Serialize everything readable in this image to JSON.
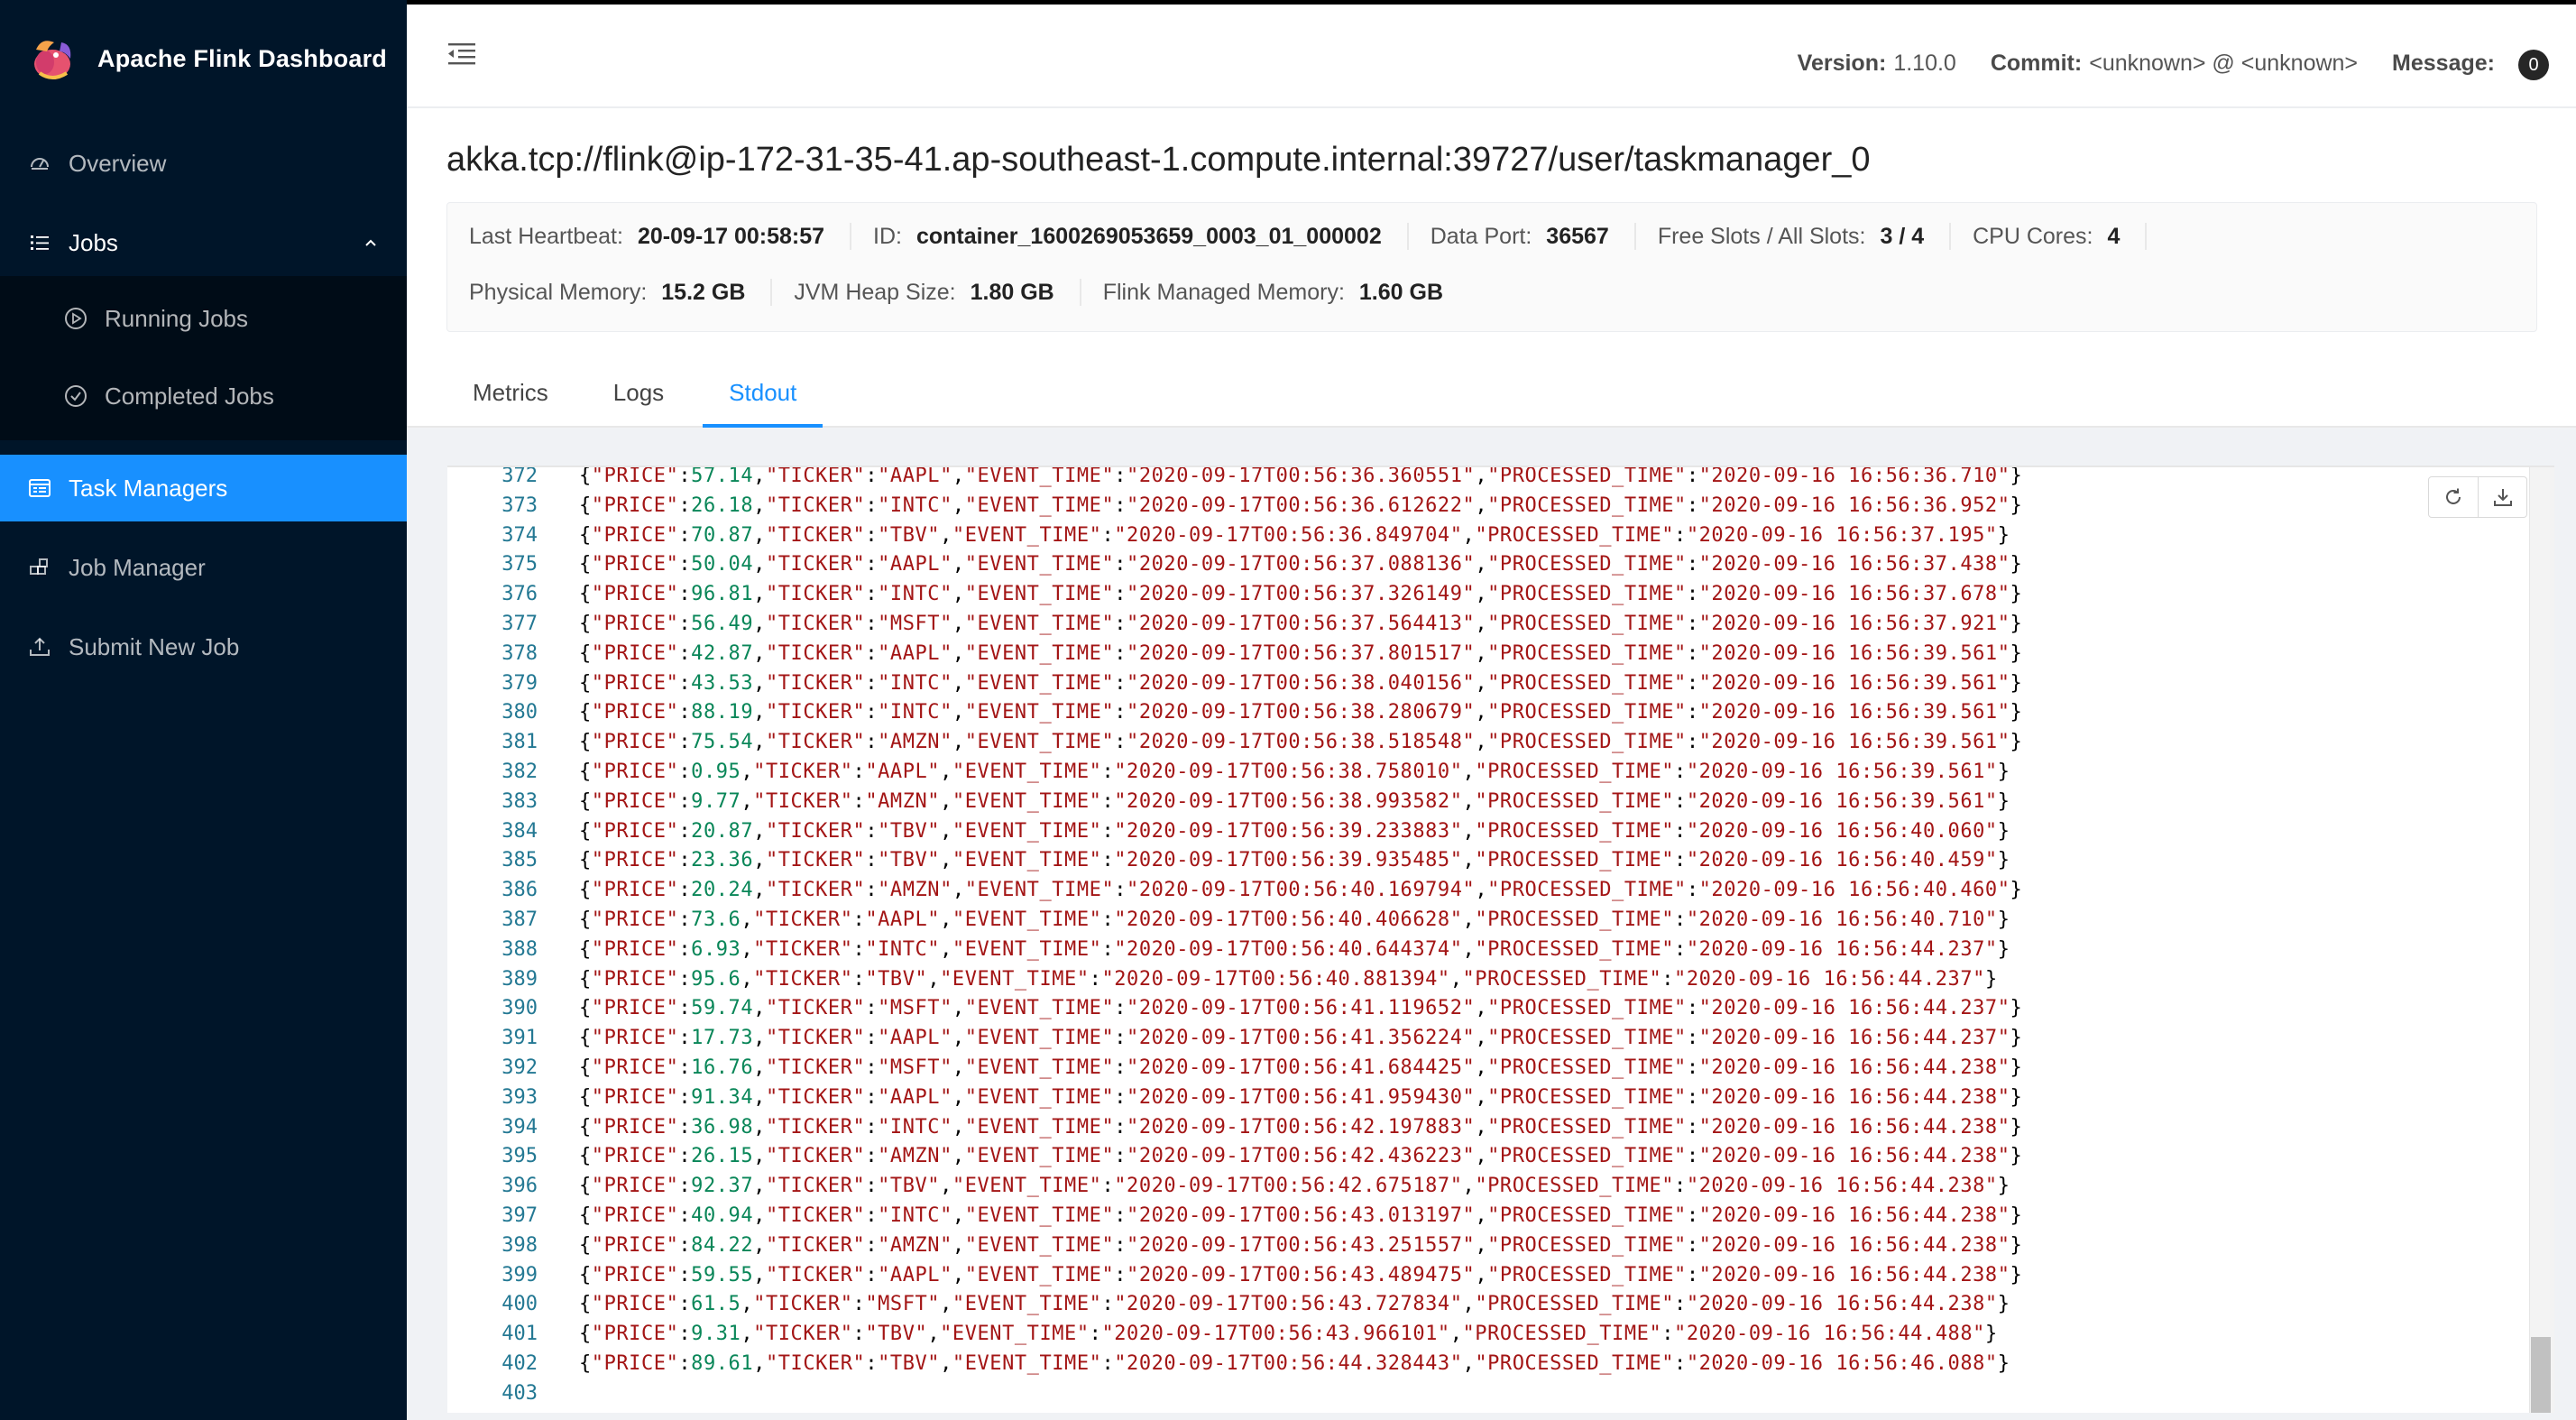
{
  "app": {
    "title": "Apache Flink Dashboard"
  },
  "sidebar": {
    "items": [
      {
        "label": "Overview",
        "icon": "dashboard-icon"
      },
      {
        "label": "Jobs",
        "icon": "list-icon",
        "expanded": true,
        "children": [
          {
            "label": "Running Jobs",
            "icon": "play-circle-icon"
          },
          {
            "label": "Completed Jobs",
            "icon": "check-circle-icon"
          }
        ]
      },
      {
        "label": "Task Managers",
        "icon": "schedule-icon",
        "active": true
      },
      {
        "label": "Job Manager",
        "icon": "build-icon"
      },
      {
        "label": "Submit New Job",
        "icon": "upload-icon"
      }
    ]
  },
  "header": {
    "version_label": "Version:",
    "version_value": "1.10.0",
    "commit_label": "Commit:",
    "commit_value": "<unknown> @ <unknown>",
    "message_label": "Message:",
    "message_count": "0"
  },
  "page": {
    "title": "akka.tcp://flink@ip-172-31-35-41.ap-southeast-1.compute.internal:39727/user/taskmanager_0",
    "details": {
      "row1": [
        {
          "key": "Last Heartbeat:",
          "value": "20-09-17 00:58:57"
        },
        {
          "key": "ID:",
          "value": "container_1600269053659_0003_01_000002"
        },
        {
          "key": "Data Port:",
          "value": "36567"
        },
        {
          "key": "Free Slots / All Slots:",
          "value": "3 / 4"
        },
        {
          "key": "CPU Cores:",
          "value": "4"
        }
      ],
      "row2": [
        {
          "key": "Physical Memory:",
          "value": "15.2 GB"
        },
        {
          "key": "JVM Heap Size:",
          "value": "1.80 GB"
        },
        {
          "key": "Flink Managed Memory:",
          "value": "1.60 GB"
        }
      ]
    },
    "tabs": [
      {
        "label": "Metrics",
        "active": false
      },
      {
        "label": "Logs",
        "active": false
      },
      {
        "label": "Stdout",
        "active": true
      }
    ]
  },
  "stdout": {
    "lines": [
      {
        "n": "372",
        "price": "57.14",
        "ticker": "AAPL",
        "event": "2020-09-17T00:56:36.360551",
        "processed": "2020-09-16 16:56:36.710"
      },
      {
        "n": "373",
        "price": "26.18",
        "ticker": "INTC",
        "event": "2020-09-17T00:56:36.612622",
        "processed": "2020-09-16 16:56:36.952"
      },
      {
        "n": "374",
        "price": "70.87",
        "ticker": "TBV",
        "event": "2020-09-17T00:56:36.849704",
        "processed": "2020-09-16 16:56:37.195"
      },
      {
        "n": "375",
        "price": "50.04",
        "ticker": "AAPL",
        "event": "2020-09-17T00:56:37.088136",
        "processed": "2020-09-16 16:56:37.438"
      },
      {
        "n": "376",
        "price": "96.81",
        "ticker": "INTC",
        "event": "2020-09-17T00:56:37.326149",
        "processed": "2020-09-16 16:56:37.678"
      },
      {
        "n": "377",
        "price": "56.49",
        "ticker": "MSFT",
        "event": "2020-09-17T00:56:37.564413",
        "processed": "2020-09-16 16:56:37.921"
      },
      {
        "n": "378",
        "price": "42.87",
        "ticker": "AAPL",
        "event": "2020-09-17T00:56:37.801517",
        "processed": "2020-09-16 16:56:39.561"
      },
      {
        "n": "379",
        "price": "43.53",
        "ticker": "INTC",
        "event": "2020-09-17T00:56:38.040156",
        "processed": "2020-09-16 16:56:39.561"
      },
      {
        "n": "380",
        "price": "88.19",
        "ticker": "INTC",
        "event": "2020-09-17T00:56:38.280679",
        "processed": "2020-09-16 16:56:39.561"
      },
      {
        "n": "381",
        "price": "75.54",
        "ticker": "AMZN",
        "event": "2020-09-17T00:56:38.518548",
        "processed": "2020-09-16 16:56:39.561"
      },
      {
        "n": "382",
        "price": "0.95",
        "ticker": "AAPL",
        "event": "2020-09-17T00:56:38.758010",
        "processed": "2020-09-16 16:56:39.561"
      },
      {
        "n": "383",
        "price": "9.77",
        "ticker": "AMZN",
        "event": "2020-09-17T00:56:38.993582",
        "processed": "2020-09-16 16:56:39.561"
      },
      {
        "n": "384",
        "price": "20.87",
        "ticker": "TBV",
        "event": "2020-09-17T00:56:39.233883",
        "processed": "2020-09-16 16:56:40.060"
      },
      {
        "n": "385",
        "price": "23.36",
        "ticker": "TBV",
        "event": "2020-09-17T00:56:39.935485",
        "processed": "2020-09-16 16:56:40.459"
      },
      {
        "n": "386",
        "price": "20.24",
        "ticker": "AMZN",
        "event": "2020-09-17T00:56:40.169794",
        "processed": "2020-09-16 16:56:40.460"
      },
      {
        "n": "387",
        "price": "73.6",
        "ticker": "AAPL",
        "event": "2020-09-17T00:56:40.406628",
        "processed": "2020-09-16 16:56:40.710"
      },
      {
        "n": "388",
        "price": "6.93",
        "ticker": "INTC",
        "event": "2020-09-17T00:56:40.644374",
        "processed": "2020-09-16 16:56:44.237"
      },
      {
        "n": "389",
        "price": "95.6",
        "ticker": "TBV",
        "event": "2020-09-17T00:56:40.881394",
        "processed": "2020-09-16 16:56:44.237"
      },
      {
        "n": "390",
        "price": "59.74",
        "ticker": "MSFT",
        "event": "2020-09-17T00:56:41.119652",
        "processed": "2020-09-16 16:56:44.237"
      },
      {
        "n": "391",
        "price": "17.73",
        "ticker": "AAPL",
        "event": "2020-09-17T00:56:41.356224",
        "processed": "2020-09-16 16:56:44.237"
      },
      {
        "n": "392",
        "price": "16.76",
        "ticker": "MSFT",
        "event": "2020-09-17T00:56:41.684425",
        "processed": "2020-09-16 16:56:44.238"
      },
      {
        "n": "393",
        "price": "91.34",
        "ticker": "AAPL",
        "event": "2020-09-17T00:56:41.959430",
        "processed": "2020-09-16 16:56:44.238"
      },
      {
        "n": "394",
        "price": "36.98",
        "ticker": "INTC",
        "event": "2020-09-17T00:56:42.197883",
        "processed": "2020-09-16 16:56:44.238"
      },
      {
        "n": "395",
        "price": "26.15",
        "ticker": "AMZN",
        "event": "2020-09-17T00:56:42.436223",
        "processed": "2020-09-16 16:56:44.238"
      },
      {
        "n": "396",
        "price": "92.37",
        "ticker": "TBV",
        "event": "2020-09-17T00:56:42.675187",
        "processed": "2020-09-16 16:56:44.238"
      },
      {
        "n": "397",
        "price": "40.94",
        "ticker": "INTC",
        "event": "2020-09-17T00:56:43.013197",
        "processed": "2020-09-16 16:56:44.238"
      },
      {
        "n": "398",
        "price": "84.22",
        "ticker": "AMZN",
        "event": "2020-09-17T00:56:43.251557",
        "processed": "2020-09-16 16:56:44.238"
      },
      {
        "n": "399",
        "price": "59.55",
        "ticker": "AAPL",
        "event": "2020-09-17T00:56:43.489475",
        "processed": "2020-09-16 16:56:44.238"
      },
      {
        "n": "400",
        "price": "61.5",
        "ticker": "MSFT",
        "event": "2020-09-17T00:56:43.727834",
        "processed": "2020-09-16 16:56:44.238"
      },
      {
        "n": "401",
        "price": "9.31",
        "ticker": "TBV",
        "event": "2020-09-17T00:56:43.966101",
        "processed": "2020-09-16 16:56:44.488"
      },
      {
        "n": "402",
        "price": "89.61",
        "ticker": "TBV",
        "event": "2020-09-17T00:56:44.328443",
        "processed": "2020-09-16 16:56:46.088"
      },
      {
        "n": "403"
      }
    ]
  },
  "colors": {
    "sidebar_bg": "#001529",
    "submenu_bg": "#000c17",
    "accent": "#1890ff",
    "json_key": "#a31515",
    "json_number": "#098658",
    "line_number": "#237893"
  }
}
